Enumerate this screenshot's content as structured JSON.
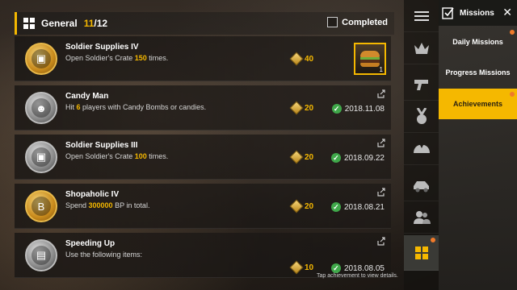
{
  "header": {
    "title": "General",
    "count_done": "11",
    "count_total": "/12",
    "completed_label": "Completed"
  },
  "achievements": [
    {
      "title": "Soldier Supplies IV",
      "desc_prefix": "Open Soldier's Crate ",
      "desc_highlight": "150",
      "desc_suffix": " times.",
      "points": "40",
      "date": "",
      "medal": "gold",
      "reward_count": "1"
    },
    {
      "title": "Candy Man",
      "desc_prefix": "Hit ",
      "desc_highlight": "6",
      "desc_suffix": " players with Candy Bombs or candies.",
      "points": "20",
      "date": "2018.11.08",
      "medal": "silver"
    },
    {
      "title": "Soldier Supplies III",
      "desc_prefix": "Open Soldier's Crate ",
      "desc_highlight": "100",
      "desc_suffix": " times.",
      "points": "20",
      "date": "2018.09.22",
      "medal": "silver"
    },
    {
      "title": "Shopaholic IV",
      "desc_prefix": "Spend ",
      "desc_highlight": "300000",
      "desc_suffix": " BP in total.",
      "points": "20",
      "date": "2018.08.21",
      "medal": "gold"
    },
    {
      "title": "Speeding Up",
      "desc_prefix": "Use the following items:",
      "desc_highlight": "",
      "desc_suffix": "",
      "points": "10",
      "date": "2018.08.05",
      "medal": "silver"
    }
  ],
  "footer_hint": "Tap achievement to view details.",
  "iconbar": [
    "menu-icon",
    "crown-icon",
    "pistol-icon",
    "medal-icon",
    "muscle-icon",
    "vehicle-icon",
    "friends-icon",
    "grid-icon"
  ],
  "menu": {
    "title": "Missions",
    "items": [
      "Daily Missions",
      "Progress Missions",
      "Achievements"
    ]
  },
  "colors": {
    "accent": "#f5b800",
    "complete": "#3fa84a",
    "reddot": "#f07a2a"
  }
}
